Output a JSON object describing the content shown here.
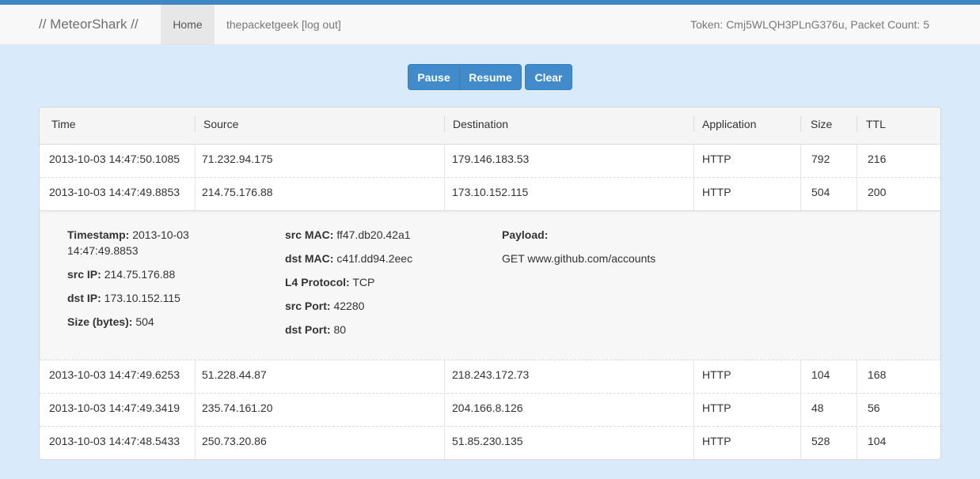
{
  "navbar": {
    "brand": "// MeteorShark //",
    "home": "Home",
    "user": "thepacketgeek [log out]",
    "status": "Token: Cmj5WLQH3PLnG376u, Packet Count: 5"
  },
  "controls": {
    "pause": "Pause",
    "resume": "Resume",
    "clear": "Clear"
  },
  "table": {
    "headers": [
      "Time",
      "Source",
      "Destination",
      "Application",
      "Size",
      "TTL"
    ],
    "rows": [
      [
        "2013-10-03 14:47:50.1085",
        "71.232.94.175",
        "179.146.183.53",
        "HTTP",
        "792",
        "216"
      ],
      [
        "2013-10-03 14:47:49.8853",
        "214.75.176.88",
        "173.10.152.115",
        "HTTP",
        "504",
        "200"
      ],
      [
        "2013-10-03 14:47:49.6253",
        "51.228.44.87",
        "218.243.172.73",
        "HTTP",
        "104",
        "168"
      ],
      [
        "2013-10-03 14:47:49.3419",
        "235.74.161.20",
        "204.166.8.126",
        "HTTP",
        "48",
        "56"
      ],
      [
        "2013-10-03 14:47:48.5433",
        "250.73.20.86",
        "51.85.230.135",
        "HTTP",
        "528",
        "104"
      ]
    ]
  },
  "detail": {
    "timestamp_label": "Timestamp:",
    "timestamp": "2013-10-03 14:47:49.8853",
    "src_ip_label": "src IP:",
    "src_ip": "214.75.176.88",
    "dst_ip_label": "dst IP:",
    "dst_ip": "173.10.152.115",
    "size_label": "Size (bytes):",
    "size": "504",
    "src_mac_label": "src MAC:",
    "src_mac": "ff47.db20.42a1",
    "dst_mac_label": "dst MAC:",
    "dst_mac": "c41f.dd94.2eec",
    "l4_label": "L4 Protocol:",
    "l4": "TCP",
    "src_port_label": "src Port:",
    "src_port": "42280",
    "dst_port_label": "dst Port:",
    "dst_port": "80",
    "payload_label": "Payload:",
    "payload": "GET www.github.com/accounts"
  },
  "colors": {
    "accent": "#428bca",
    "background": "#d9ebfb",
    "stripe": "#3f87c4"
  }
}
